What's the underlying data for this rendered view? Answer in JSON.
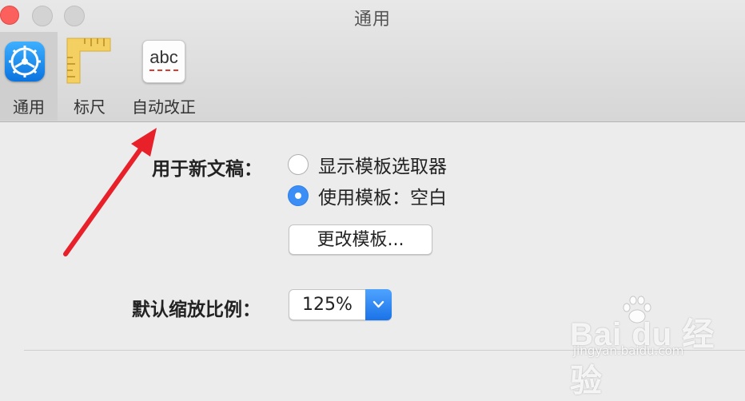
{
  "window": {
    "title": "通用"
  },
  "toolbar": {
    "tabs": [
      {
        "label": "通用",
        "icon": "gear-icon",
        "selected": true
      },
      {
        "label": "标尺",
        "icon": "ruler-icon",
        "selected": false
      },
      {
        "label": "自动改正",
        "icon": "abc-spellcheck-icon",
        "selected": false,
        "icon_text": "abc"
      }
    ]
  },
  "settings": {
    "new_document_label": "用于新文稿：",
    "option_show_chooser": "显示模板选取器",
    "option_use_template": "使用模板：空白",
    "selected_option": "option_use_template",
    "change_template_button": "更改模板...",
    "zoom_label": "默认缩放比例：",
    "zoom_value": "125%"
  },
  "watermark": {
    "brand": "Bai du 经验",
    "url": "jingyan.baidu.com"
  },
  "colors": {
    "accent": "#3b8ef5",
    "close_button": "#fc605c",
    "annotation_arrow": "#e8202a"
  }
}
